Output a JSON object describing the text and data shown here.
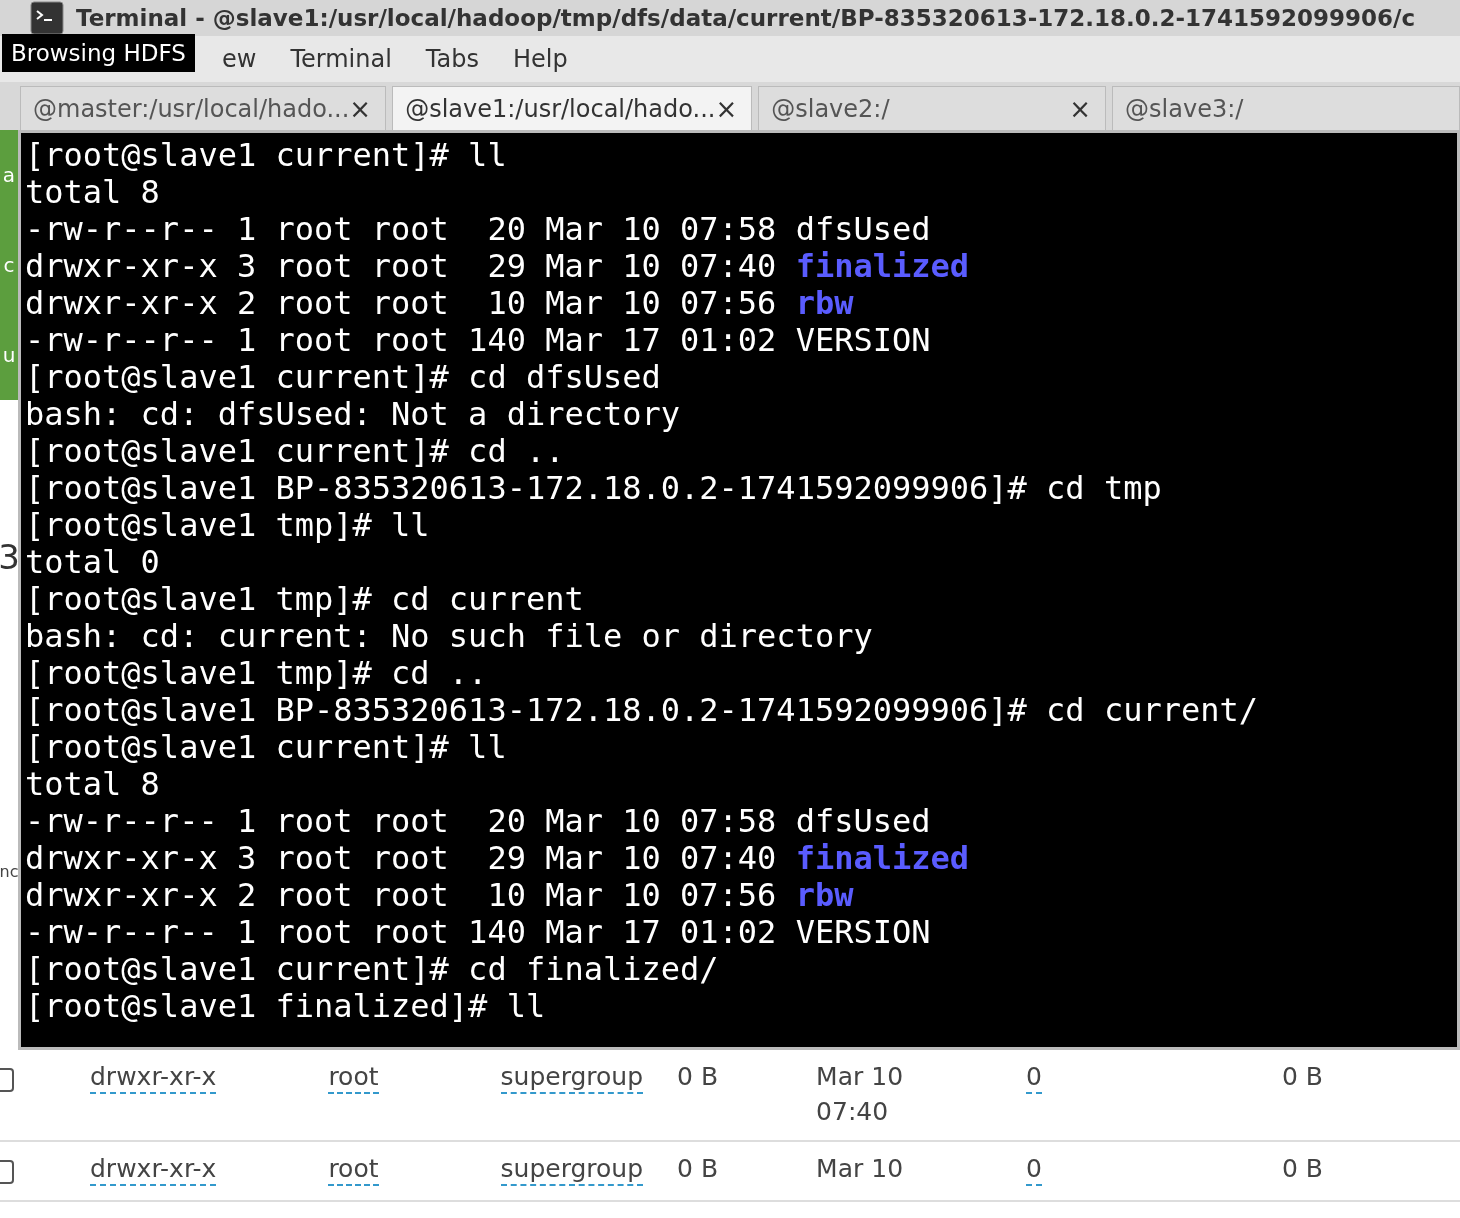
{
  "window": {
    "title": "Terminal - @slave1:/usr/local/hadoop/tmp/dfs/data/current/BP-835320613-172.18.0.2-1741592099906/c"
  },
  "tooltip": "Browsing HDFS",
  "menu": [
    "ew",
    "Terminal",
    "Tabs",
    "Help"
  ],
  "tabs": [
    {
      "label": "@master:/usr/local/hado...",
      "close": "×",
      "selected": false
    },
    {
      "label": "@slave1:/usr/local/hado...",
      "close": "×",
      "selected": true
    },
    {
      "label": "@slave2:/",
      "close": "×",
      "selected": false
    },
    {
      "label": "@slave3:/",
      "selected": false
    }
  ],
  "background_fragments": [
    {
      "text": "a",
      "kind": "panel"
    },
    {
      "text": "c",
      "kind": "panel"
    },
    {
      "text": "u",
      "kind": "panel"
    },
    {
      "text": "3",
      "kind": "big"
    },
    {
      "text": "nc",
      "kind": "page"
    }
  ],
  "terminal_lines": [
    [
      {
        "text": "[root@slave1 current]# ll",
        "kind": "plain"
      }
    ],
    [
      {
        "text": "total 8",
        "kind": "plain"
      }
    ],
    [
      {
        "text": "-rw-r--r-- 1 root root  20 Mar 10 07:58 dfsUsed",
        "kind": "plain"
      }
    ],
    [
      {
        "text": "drwxr-xr-x 3 root root  29 Mar 10 07:40 ",
        "kind": "plain"
      },
      {
        "text": "finalized",
        "kind": "dir"
      }
    ],
    [
      {
        "text": "drwxr-xr-x 2 root root  10 Mar 10 07:56 ",
        "kind": "plain"
      },
      {
        "text": "rbw",
        "kind": "dir"
      }
    ],
    [
      {
        "text": "-rw-r--r-- 1 root root 140 Mar 17 01:02 VERSION",
        "kind": "plain"
      }
    ],
    [
      {
        "text": "[root@slave1 current]# cd dfsUsed",
        "kind": "plain"
      }
    ],
    [
      {
        "text": "bash: cd: dfsUsed: Not a directory",
        "kind": "plain"
      }
    ],
    [
      {
        "text": "[root@slave1 current]# cd ..",
        "kind": "plain"
      }
    ],
    [
      {
        "text": "[root@slave1 BP-835320613-172.18.0.2-1741592099906]# cd tmp",
        "kind": "plain"
      }
    ],
    [
      {
        "text": "[root@slave1 tmp]# ll",
        "kind": "plain"
      }
    ],
    [
      {
        "text": "total 0",
        "kind": "plain"
      }
    ],
    [
      {
        "text": "[root@slave1 tmp]# cd current",
        "kind": "plain"
      }
    ],
    [
      {
        "text": "bash: cd: current: No such file or directory",
        "kind": "plain"
      }
    ],
    [
      {
        "text": "[root@slave1 tmp]# cd ..",
        "kind": "plain"
      }
    ],
    [
      {
        "text": "[root@slave1 BP-835320613-172.18.0.2-1741592099906]# cd current/",
        "kind": "plain"
      }
    ],
    [
      {
        "text": "[root@slave1 current]# ll",
        "kind": "plain"
      }
    ],
    [
      {
        "text": "total 8",
        "kind": "plain"
      }
    ],
    [
      {
        "text": "-rw-r--r-- 1 root root  20 Mar 10 07:58 dfsUsed",
        "kind": "plain"
      }
    ],
    [
      {
        "text": "drwxr-xr-x 3 root root  29 Mar 10 07:40 ",
        "kind": "plain"
      },
      {
        "text": "finalized",
        "kind": "dir"
      }
    ],
    [
      {
        "text": "drwxr-xr-x 2 root root  10 Mar 10 07:56 ",
        "kind": "plain"
      },
      {
        "text": "rbw",
        "kind": "dir"
      }
    ],
    [
      {
        "text": "-rw-r--r-- 1 root root 140 Mar 17 01:02 VERSION",
        "kind": "plain"
      }
    ],
    [
      {
        "text": "[root@slave1 current]# cd finalized/",
        "kind": "plain"
      }
    ],
    [
      {
        "text": "[root@slave1 finalized]# ll",
        "kind": "plain"
      }
    ]
  ],
  "hdfs_rows": [
    {
      "checked": false,
      "permission": "drwxr-xr-x",
      "owner": "root",
      "group": "supergroup",
      "size": "0 B",
      "last_modified": [
        "Mar 10",
        "07:40"
      ],
      "replication": "0",
      "block_size": "0 B"
    },
    {
      "checked": false,
      "permission": "drwxr-xr-x",
      "owner": "root",
      "group": "supergroup",
      "size": "0 B",
      "last_modified": [
        "Mar 10"
      ],
      "replication": "0",
      "block_size": "0 B"
    }
  ]
}
